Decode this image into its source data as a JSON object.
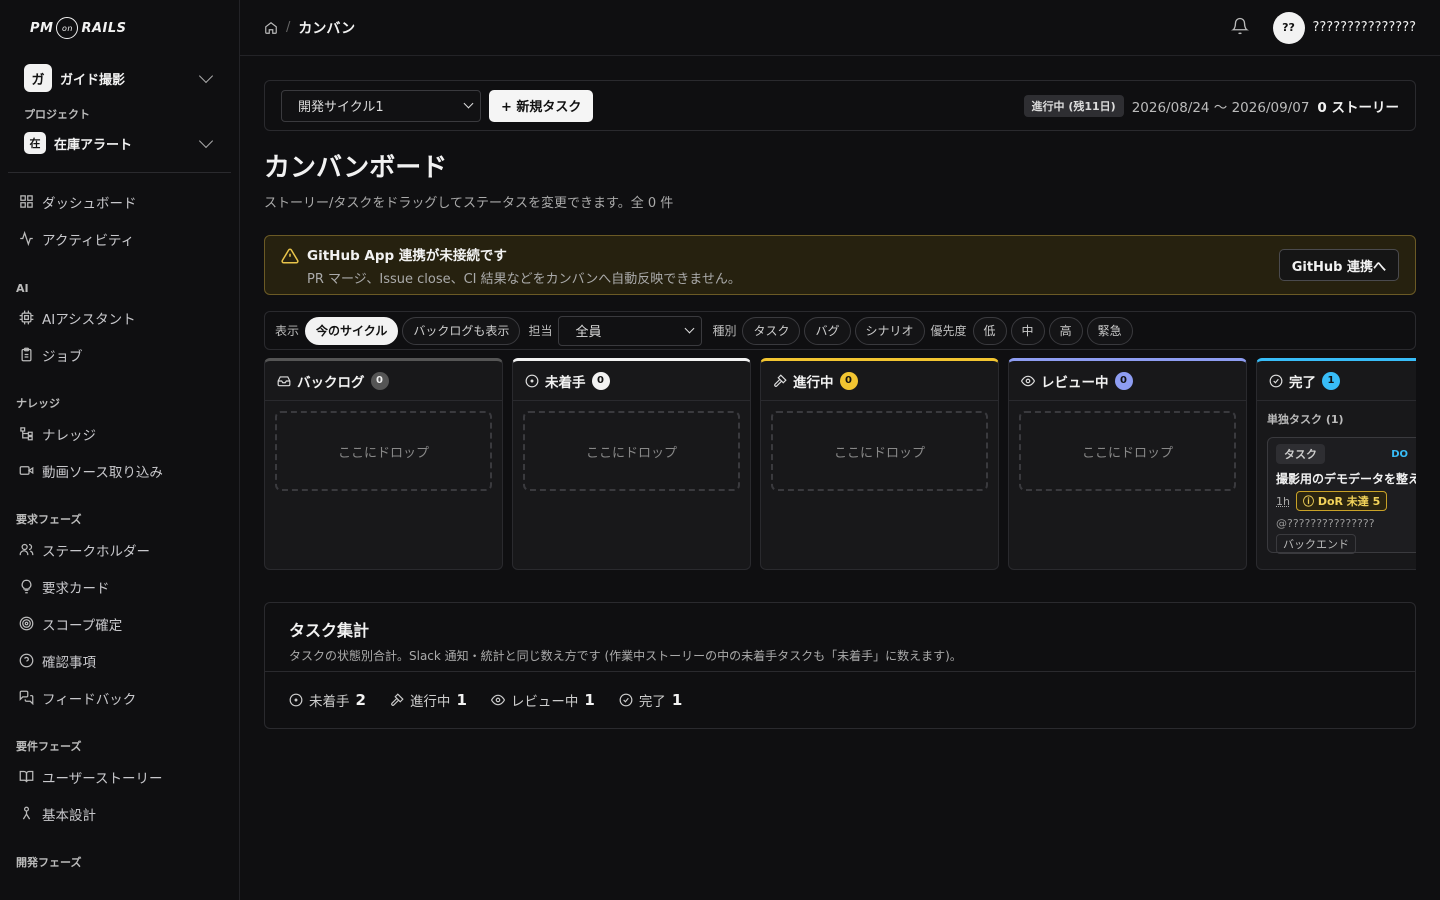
{
  "app": {
    "logo_left": "PM",
    "logo_mid": "on",
    "logo_right": "RAILS"
  },
  "sidebar": {
    "workspace": {
      "initial": "ガ",
      "name": "ガイド撮影"
    },
    "project_label": "プロジェクト",
    "project": {
      "initial": "在",
      "name": "在庫アラート"
    },
    "top_items": [
      {
        "label": "ダッシュボード",
        "icon": "grid-icon"
      },
      {
        "label": "アクティビティ",
        "icon": "activity-icon"
      }
    ],
    "groups": [
      {
        "label": "AI",
        "items": [
          {
            "label": "AIアシスタント",
            "icon": "cpu-icon"
          },
          {
            "label": "ジョブ",
            "icon": "clipboard-icon"
          }
        ]
      },
      {
        "label": "ナレッジ",
        "items": [
          {
            "label": "ナレッジ",
            "icon": "tree-icon"
          },
          {
            "label": "動画ソース取り込み",
            "icon": "video-icon"
          }
        ]
      },
      {
        "label": "要求フェーズ",
        "items": [
          {
            "label": "ステークホルダー",
            "icon": "users-icon"
          },
          {
            "label": "要求カード",
            "icon": "lightbulb-icon"
          },
          {
            "label": "スコープ確定",
            "icon": "target-icon"
          },
          {
            "label": "確認事項",
            "icon": "question-icon"
          },
          {
            "label": "フィードバック",
            "icon": "chat-icon"
          }
        ]
      },
      {
        "label": "要件フェーズ",
        "items": [
          {
            "label": "ユーザーストーリー",
            "icon": "book-icon"
          },
          {
            "label": "基本設計",
            "icon": "person-icon"
          }
        ]
      },
      {
        "label": "開発フェーズ",
        "items": []
      }
    ]
  },
  "topbar": {
    "breadcrumb_current": "カンバン",
    "breadcrumb_sep": "/",
    "avatar_initials": "??",
    "user_name": "???????????????"
  },
  "cycle": {
    "selected": "開発サイクル1",
    "new_task_label": "+ 新規タスク",
    "status_badge": "進行中 (残11日)",
    "date_range": "2026/08/24 〜 2026/09/07",
    "stories": "0 ストーリー"
  },
  "page": {
    "title": "カンバンボード",
    "subtitle": "ストーリー/タスクをドラッグしてステータスを変更できます。全 0 件"
  },
  "alert": {
    "title": "GitHub App 連携が未接続です",
    "desc": "PR マージ、Issue close、CI 結果などをカンバンへ自動反映できません。",
    "button": "GitHub 連携へ",
    "color": "#e8c44a"
  },
  "filters": {
    "display_label": "表示",
    "display_options": [
      "今のサイクル",
      "バックログも表示"
    ],
    "assignee_label": "担当",
    "assignee_selected": "全員",
    "type_label": "種別",
    "type_options": [
      "タスク",
      "バグ",
      "シナリオ"
    ],
    "priority_label": "優先度",
    "priority_options": [
      "低",
      "中",
      "高",
      "緊急"
    ]
  },
  "columns": [
    {
      "name": "バックログ",
      "count": "0",
      "icon": "inbox-icon",
      "accent": "#555555",
      "badge_bg": "#555555",
      "badge_fg": "#eeeeee",
      "drop": "ここにドロップ"
    },
    {
      "name": "未着手",
      "count": "0",
      "icon": "circle-dot-icon",
      "accent": "#f2f2f2",
      "badge_bg": "#f2f2f2",
      "badge_fg": "#111111",
      "drop": "ここにドロップ"
    },
    {
      "name": "進行中",
      "count": "0",
      "icon": "hammer-icon",
      "accent": "#f2c531",
      "badge_bg": "#f2c531",
      "badge_fg": "#111111",
      "drop": "ここにドロップ"
    },
    {
      "name": "レビュー中",
      "count": "0",
      "icon": "eye-icon",
      "accent": "#8e9df2",
      "badge_bg": "#8e9df2",
      "badge_fg": "#111111",
      "drop": "ここにドロップ"
    },
    {
      "name": "完了",
      "count": "1",
      "icon": "check-circle-icon",
      "accent": "#38bdf8",
      "badge_bg": "#38bdf8",
      "badge_fg": "#111111"
    }
  ],
  "done_column": {
    "subgroup": "単独タスク (1)",
    "card": {
      "tag": "タスク",
      "tag_right": "DO",
      "title": "撮影用のデモデータを整え",
      "estimate": "1h",
      "dor": "DoR 未達 5",
      "assignee": "@???????????????",
      "label": "バックエンド"
    }
  },
  "summary": {
    "title": "タスク集計",
    "desc": "タスクの状態別合計。Slack 通知・統計と同じ数え方です (作業中ストーリーの中の未着手タスクも「未着手」に数えます)。",
    "stats": [
      {
        "label": "未着手",
        "value": "2",
        "icon": "circle-dot-icon"
      },
      {
        "label": "進行中",
        "value": "1",
        "icon": "hammer-icon"
      },
      {
        "label": "レビュー中",
        "value": "1",
        "icon": "eye-icon"
      },
      {
        "label": "完了",
        "value": "1",
        "icon": "check-circle-icon"
      }
    ]
  }
}
